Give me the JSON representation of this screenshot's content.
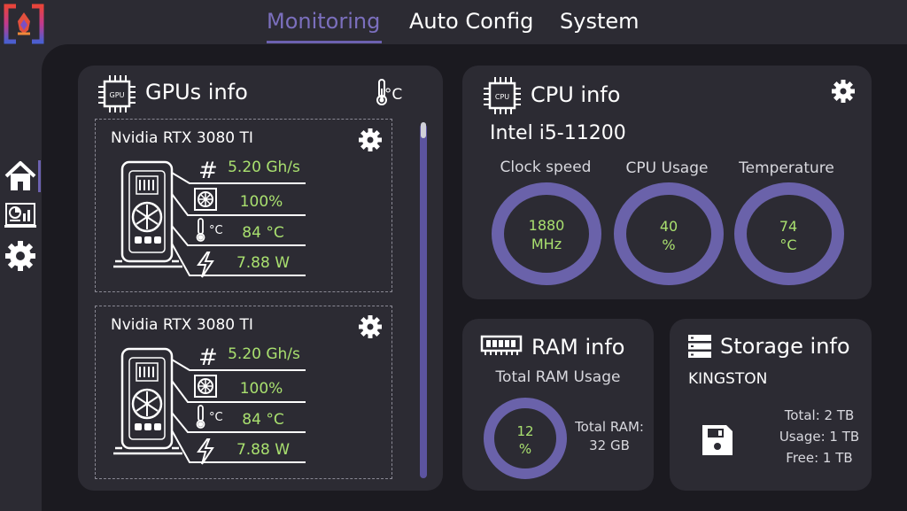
{
  "nav": {
    "tabs": [
      {
        "label": "Monitoring",
        "active": true
      },
      {
        "label": "Auto Config",
        "active": false
      },
      {
        "label": "System",
        "active": false
      }
    ]
  },
  "sidebar": {
    "items": [
      {
        "icon": "home-icon",
        "active": true
      },
      {
        "icon": "dashboard-icon",
        "active": false
      },
      {
        "icon": "gear-icon",
        "active": false
      }
    ]
  },
  "gpus": {
    "title": "GPUs info",
    "chip_text": "GPU",
    "temp_unit_label": "°C",
    "cards": [
      {
        "name": "Nvidia RTX 3080 TI",
        "hashrate": "5.20 Gh/s",
        "fan": "100%",
        "temperature": "84 °C",
        "power": "7.88 W"
      },
      {
        "name": "Nvidia RTX 3080 TI",
        "hashrate": "5.20 Gh/s",
        "fan": "100%",
        "temperature": "84 °C",
        "power": "7.88 W"
      }
    ]
  },
  "cpu": {
    "title": "CPU info",
    "chip_text": "CPU",
    "model": "Intel i5-11200",
    "metrics": [
      {
        "label": "Clock speed",
        "value": "1880",
        "unit": "MHz"
      },
      {
        "label": "CPU Usage",
        "value": "40",
        "unit": "%"
      },
      {
        "label": "Temperature",
        "value": "74",
        "unit": "°C"
      }
    ]
  },
  "ram": {
    "title": "RAM info",
    "usage_label": "Total RAM Usage",
    "usage_value": "12",
    "usage_unit": "%",
    "total_label": "Total RAM:",
    "total_value": "32 GB"
  },
  "storage": {
    "title": "Storage info",
    "device": "KINGSTON",
    "total": "Total: 2 TB",
    "usage": "Usage: 1 TB",
    "free": "Free: 1 TB"
  },
  "colors": {
    "accent": "#6c61b0",
    "value_green": "#a9e06f",
    "panel": "#2c2b33",
    "background": "#1b1a20",
    "ring": "#6a62aa"
  }
}
